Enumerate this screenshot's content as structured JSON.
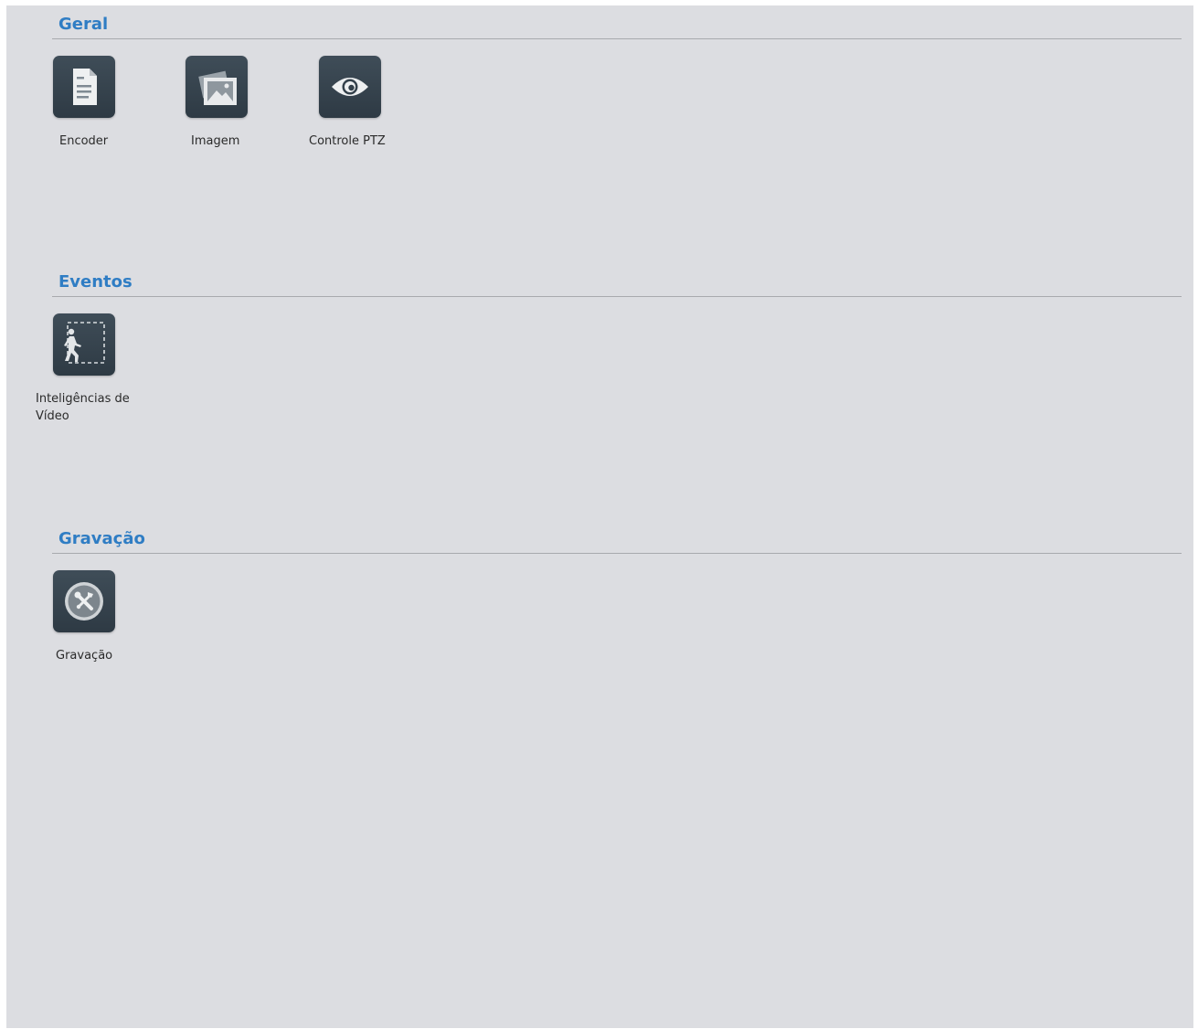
{
  "sections": [
    {
      "title": "Geral",
      "items": [
        {
          "label": "Encoder",
          "icon": "document-icon"
        },
        {
          "label": "Imagem",
          "icon": "image-icon"
        },
        {
          "label": "Controle PTZ",
          "icon": "eye-icon"
        }
      ]
    },
    {
      "title": "Eventos",
      "items": [
        {
          "label_line1": "Inteligências de",
          "label_line2": "Vídeo",
          "icon": "walking-person-icon"
        }
      ]
    },
    {
      "title": "Gravação",
      "items": [
        {
          "label": "Gravação",
          "icon": "tools-icon"
        }
      ]
    }
  ],
  "colors": {
    "background": "#dcdde1",
    "section_title": "#2f7dc4",
    "tile": "#34414b",
    "divider": "#a8aaae"
  }
}
